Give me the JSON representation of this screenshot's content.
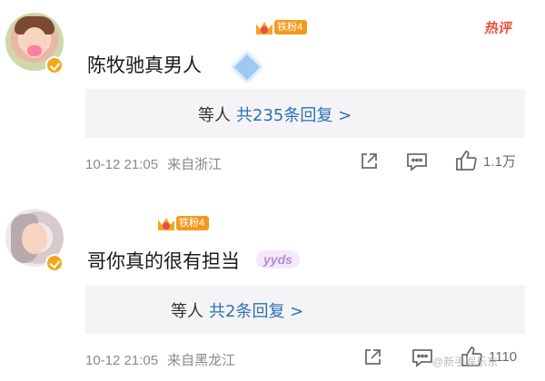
{
  "comments": [
    {
      "avatar_icon": "boy-avatar",
      "fan_badge": "铁粉4",
      "hot_tag": "热评",
      "text": "陈牧驰真男人",
      "replies": {
        "who": "等人",
        "count_text": "共235条回复 >"
      },
      "time": "10-12 21:05",
      "location": "来自浙江",
      "like_count": "1.1万"
    },
    {
      "avatar_icon": "woman-avatar",
      "fan_badge": "铁粉4",
      "sticker": "yyds",
      "text": "哥你真的很有担当",
      "replies": {
        "who": "等人",
        "count_text": "共2条回复 >"
      },
      "time": "10-12 21:05",
      "location": "来自黑龙江",
      "like_count": "1110"
    }
  ],
  "watermark": "@新手娱乐东",
  "colors": {
    "link": "#2e6fb4",
    "badge": "#f39a1e",
    "hot": "#e8503a",
    "reply_bg": "#f4f4f6",
    "meta": "#8a8a8a"
  }
}
